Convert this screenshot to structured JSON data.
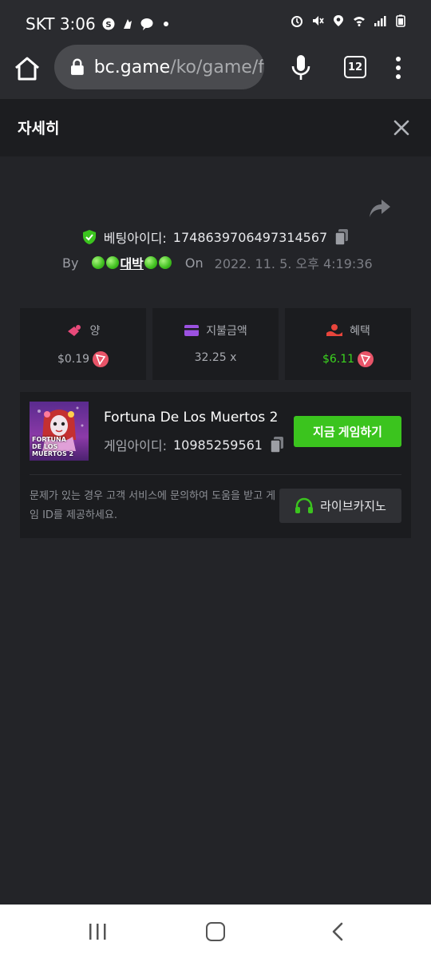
{
  "status_bar": {
    "carrier_time": "SKT 3:06",
    "icons": [
      "skype-icon",
      "notification-icon",
      "talk-icon",
      "alarm-icon",
      "mute-icon",
      "location-icon",
      "wifi-icon",
      "signal-icon",
      "battery-icon"
    ]
  },
  "browser": {
    "url_domain": "bc.game",
    "url_path": "/ko/game/f",
    "tab_count": "12"
  },
  "dialog": {
    "title": "자세히",
    "bet_id_label": "베팅아이디:",
    "bet_id": "1748639706497314567",
    "by_label": "By",
    "user": "대박",
    "on_label": "On",
    "date": "2022. 11. 5. 오후 4:19:36"
  },
  "stats": [
    {
      "label": "양",
      "value": "$0.19",
      "icon": "bet-amount-icon",
      "value_color": "#a9abb1"
    },
    {
      "label": "지불금액",
      "value": "32.25 x",
      "icon": "payout-card-icon",
      "value_color": "#a9abb1"
    },
    {
      "label": "혜택",
      "value": "$6.11",
      "icon": "profit-hand-icon",
      "value_color": "#3bd41f"
    }
  ],
  "game": {
    "name": "Fortuna De Los Muertos 2",
    "thumb_title_1": "FORTUNA",
    "thumb_title_2": "DE LOS MUERTOS 2",
    "id_label": "게임아이디:",
    "id": "10985259561",
    "play_label": "지금 게임하기",
    "help": "문제가 있는 경우 고객 서비스에 문의하여 도움을 받고 게임 ID를 제공하세요.",
    "live_label": "라이브카지노"
  },
  "colors": {
    "accent_green": "#3bc41e",
    "coin": "#e85468",
    "bg": "#232428",
    "panel": "#1b1c1f"
  }
}
